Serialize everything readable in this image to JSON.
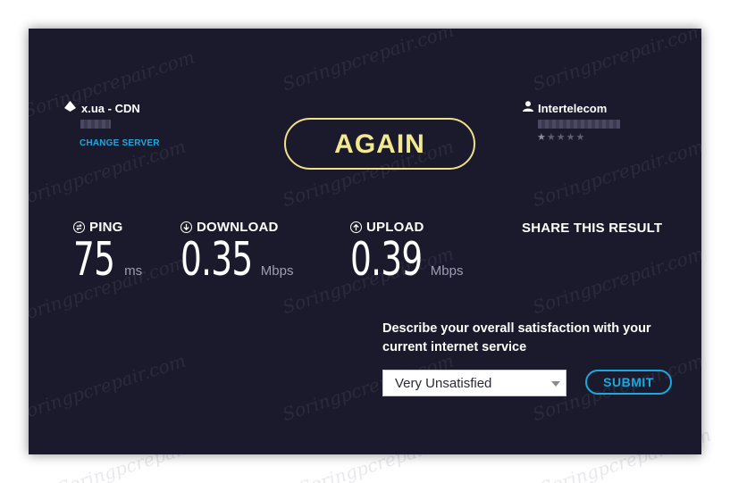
{
  "watermark": "Soringpcrepair.com",
  "server": {
    "name": "x.ua - CDN",
    "change_server": "CHANGE SERVER"
  },
  "isp": {
    "name": "Intertelecom",
    "rating": 1,
    "rating_max": 5
  },
  "again_button": "AGAIN",
  "metrics": {
    "ping": {
      "label": "PING",
      "value": "75",
      "unit": "ms"
    },
    "download": {
      "label": "DOWNLOAD",
      "value": "0.35",
      "unit": "Mbps"
    },
    "upload": {
      "label": "UPLOAD",
      "value": "0.39",
      "unit": "Mbps"
    }
  },
  "share": "SHARE THIS RESULT",
  "survey": {
    "question": "Describe your overall satisfaction with your current internet service",
    "selected": "Very Unsatisfied",
    "submit": "SUBMIT"
  },
  "colors": {
    "background": "#1b1a2d",
    "accent_yellow": "#f3e98f",
    "accent_blue": "#1ca8dd"
  },
  "icons": {
    "server": "droplet-icon",
    "isp": "user-icon",
    "ping": "ping-icon",
    "download": "download-arrow-icon",
    "upload": "upload-arrow-icon"
  }
}
